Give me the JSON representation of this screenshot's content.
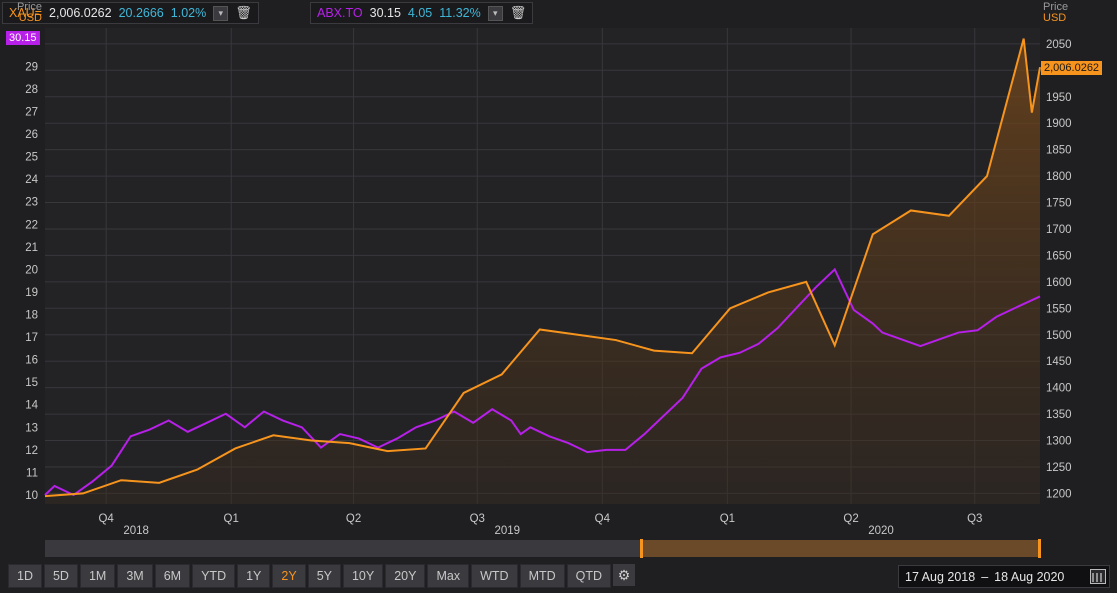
{
  "legend": [
    {
      "name": "XAU=",
      "last": "2,006.0262",
      "change": "20.2666",
      "pct": "1.02%",
      "color": "#f7941d"
    },
    {
      "name": "ABX.TO",
      "last": "30.15",
      "change": "4.05",
      "pct": "11.32%",
      "color": "#b620e8"
    }
  ],
  "left_axis_head": {
    "line1": "Price",
    "line2": "USD"
  },
  "right_axis_head": {
    "line1": "Price",
    "line2": "USD"
  },
  "left_tag": "30.15",
  "right_tag": "2,006.0262",
  "period_buttons": [
    "1D",
    "5D",
    "1M",
    "3M",
    "6M",
    "YTD",
    "1Y",
    "2Y",
    "5Y",
    "10Y",
    "20Y",
    "Max",
    "WTD",
    "MTD",
    "QTD"
  ],
  "active_period": "2Y",
  "date_range": {
    "from": "17 Aug 2018",
    "sep": "–",
    "to": "18 Aug 2020"
  },
  "chart_data": {
    "type": "line",
    "x_range": [
      "2018-08-17",
      "2020-08-18"
    ],
    "x_quarter_labels": [
      "Q4",
      "Q1",
      "Q2",
      "Q3",
      "Q4",
      "Q1",
      "Q2",
      "Q3"
    ],
    "x_year_labels": [
      "2018",
      "2019",
      "2020"
    ],
    "left_axis": {
      "ticks": [
        10,
        11,
        12,
        13,
        14,
        15,
        16,
        17,
        18,
        19,
        20,
        21,
        22,
        23,
        24,
        25,
        26,
        27,
        28,
        29
      ],
      "range": [
        9.6,
        30.7
      ]
    },
    "right_axis": {
      "ticks": [
        1200,
        1250,
        1300,
        1350,
        1400,
        1450,
        1500,
        1550,
        1600,
        1650,
        1700,
        1750,
        1800,
        1850,
        1900,
        1950,
        2000,
        2050
      ],
      "range": [
        1180,
        2080
      ]
    },
    "series": [
      {
        "name": "ABX.TO",
        "axis": "left",
        "color": "#b620e8",
        "points": [
          [
            "2018-08-17",
            10.0
          ],
          [
            "2018-08-24",
            10.4
          ],
          [
            "2018-09-07",
            10.0
          ],
          [
            "2018-09-21",
            10.6
          ],
          [
            "2018-10-05",
            11.3
          ],
          [
            "2018-10-19",
            12.6
          ],
          [
            "2018-11-02",
            12.9
          ],
          [
            "2018-11-16",
            13.3
          ],
          [
            "2018-11-30",
            12.8
          ],
          [
            "2018-12-14",
            13.2
          ],
          [
            "2018-12-28",
            13.6
          ],
          [
            "2019-01-11",
            13.0
          ],
          [
            "2019-01-25",
            13.7
          ],
          [
            "2019-02-08",
            13.3
          ],
          [
            "2019-02-22",
            13.0
          ],
          [
            "2019-03-08",
            12.1
          ],
          [
            "2019-03-22",
            12.7
          ],
          [
            "2019-04-05",
            12.5
          ],
          [
            "2019-04-19",
            12.1
          ],
          [
            "2019-05-03",
            12.5
          ],
          [
            "2019-05-17",
            13.0
          ],
          [
            "2019-05-31",
            13.3
          ],
          [
            "2019-06-14",
            13.7
          ],
          [
            "2019-06-28",
            13.2
          ],
          [
            "2019-07-12",
            13.8
          ],
          [
            "2019-07-26",
            13.3
          ],
          [
            "2019-08-02",
            12.7
          ],
          [
            "2019-08-09",
            13.0
          ],
          [
            "2019-08-23",
            12.6
          ],
          [
            "2019-09-06",
            12.3
          ],
          [
            "2019-09-20",
            11.9
          ],
          [
            "2019-10-04",
            12.0
          ],
          [
            "2019-10-18",
            12.0
          ],
          [
            "2019-11-01",
            12.7
          ],
          [
            "2019-11-15",
            13.5
          ],
          [
            "2019-11-29",
            14.3
          ],
          [
            "2019-12-13",
            15.6
          ],
          [
            "2019-12-27",
            16.1
          ],
          [
            "2020-01-10",
            16.3
          ],
          [
            "2020-01-24",
            16.7
          ],
          [
            "2020-02-07",
            17.4
          ],
          [
            "2020-02-21",
            18.3
          ],
          [
            "2020-03-06",
            19.2
          ],
          [
            "2020-03-20",
            20.0
          ],
          [
            "2020-03-27",
            19.1
          ],
          [
            "2020-04-03",
            18.2
          ],
          [
            "2020-04-17",
            17.6
          ],
          [
            "2020-04-24",
            17.2
          ],
          [
            "2020-05-08",
            16.9
          ],
          [
            "2020-05-22",
            16.6
          ],
          [
            "2020-06-05",
            16.9
          ],
          [
            "2020-06-19",
            17.2
          ],
          [
            "2020-07-03",
            17.3
          ],
          [
            "2020-07-17",
            17.9
          ],
          [
            "2020-07-31",
            18.3
          ],
          [
            "2020-08-18",
            18.8
          ]
        ]
      },
      {
        "name": "XAU=",
        "axis": "right",
        "color": "#f7941d",
        "points": [
          [
            "2018-08-17",
            1195
          ],
          [
            "2018-09-14",
            1200
          ],
          [
            "2018-10-12",
            1225
          ],
          [
            "2018-11-09",
            1220
          ],
          [
            "2018-12-07",
            1245
          ],
          [
            "2019-01-04",
            1285
          ],
          [
            "2019-02-01",
            1310
          ],
          [
            "2019-03-01",
            1300
          ],
          [
            "2019-03-29",
            1295
          ],
          [
            "2019-04-26",
            1280
          ],
          [
            "2019-05-24",
            1285
          ],
          [
            "2019-06-21",
            1390
          ],
          [
            "2019-07-19",
            1425
          ],
          [
            "2019-08-16",
            1510
          ],
          [
            "2019-09-13",
            1500
          ],
          [
            "2019-10-11",
            1490
          ],
          [
            "2019-11-08",
            1470
          ],
          [
            "2019-12-06",
            1465
          ],
          [
            "2020-01-03",
            1550
          ],
          [
            "2020-01-31",
            1580
          ],
          [
            "2020-02-28",
            1600
          ],
          [
            "2020-03-20",
            1480
          ],
          [
            "2020-04-17",
            1690
          ],
          [
            "2020-05-15",
            1735
          ],
          [
            "2020-06-12",
            1725
          ],
          [
            "2020-07-10",
            1800
          ],
          [
            "2020-08-06",
            2060
          ],
          [
            "2020-08-12",
            1920
          ],
          [
            "2020-08-18",
            2006
          ]
        ]
      }
    ]
  }
}
